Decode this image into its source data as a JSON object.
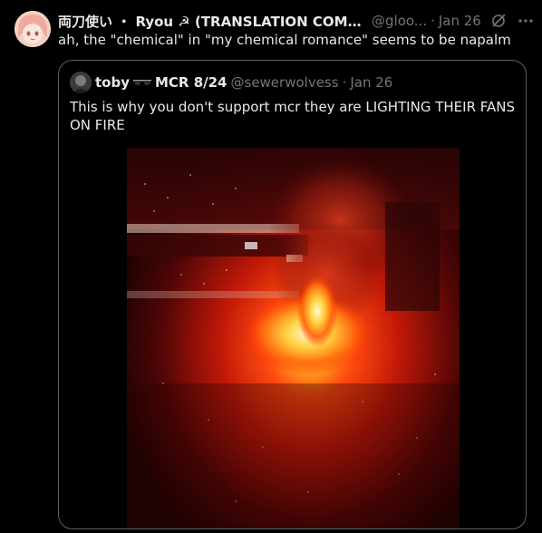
{
  "post": {
    "author_name": "両刀使い ・ Ryou ☭ (TRANSLATION COMMS P...",
    "handle": "@gloo...",
    "separator": "·",
    "date": "Jan 26",
    "text": "ah, the \"chemical\" in \"my chemical romance\" seems to be napalm"
  },
  "quote": {
    "author_name": "toby",
    "author_suffix": "MCR 8/24",
    "handle": "@sewerwolvess",
    "separator": "·",
    "date": "Jan 26",
    "text": "This is why you don't support mcr they are LIGHTING THEIR FANS ON FIRE"
  },
  "icons": {
    "grok": "grok-icon",
    "more": "more-icon",
    "sunglasses": "sunglasses-emoji"
  },
  "colors": {
    "background": "#000000",
    "text": "#e7e9ea",
    "secondary": "#71767b",
    "border": "#536471"
  }
}
